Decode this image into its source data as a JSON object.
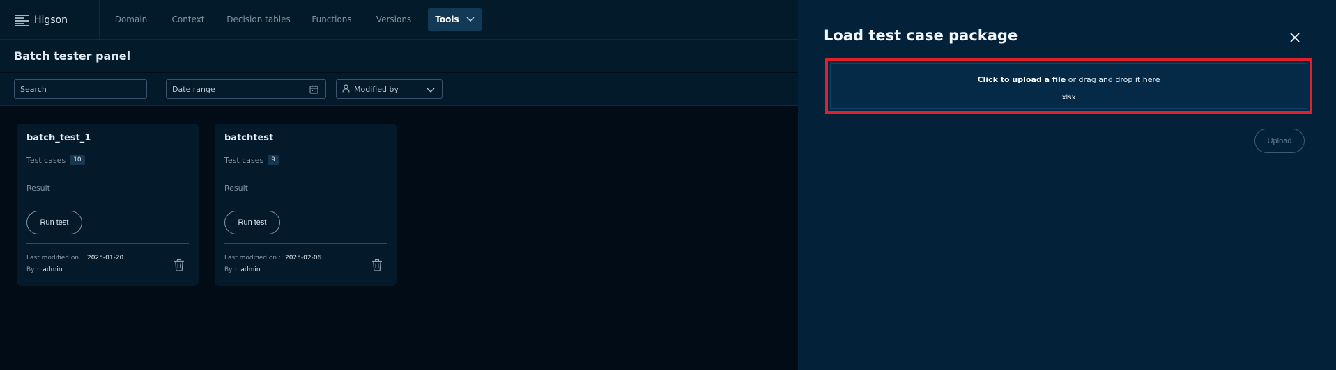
{
  "app": {
    "name": "Higson"
  },
  "nav": {
    "items": [
      {
        "label": "Domain"
      },
      {
        "label": "Context"
      },
      {
        "label": "Decision tables"
      },
      {
        "label": "Functions"
      },
      {
        "label": "Versions"
      }
    ],
    "tools": {
      "label": "Tools",
      "icon": "chevron-down-icon"
    }
  },
  "page": {
    "title": "Batch tester panel"
  },
  "filters": {
    "search_placeholder": "Search",
    "date_range": "Date range",
    "modified_by": "Modified by"
  },
  "cards": [
    {
      "title": "batch_test_1",
      "test_cases_label": "Test cases",
      "test_cases_count": "10",
      "result_label": "Result",
      "run_label": "Run test",
      "modified_label": "Last modified on :",
      "modified_date": "2025-01-20",
      "by_label": "By :",
      "by_user": "admin"
    },
    {
      "title": "batchtest",
      "test_cases_label": "Test cases",
      "test_cases_count": "9",
      "result_label": "Result",
      "run_label": "Run test",
      "modified_label": "Last modified on :",
      "modified_date": "2025-02-06",
      "by_label": "By :",
      "by_user": "admin"
    }
  ],
  "panel": {
    "title": "Load test case package",
    "upload_click": "Click to upload a file",
    "upload_rest": " or drag and drop it here",
    "upload_ext": "xlsx",
    "upload_button": "Upload"
  },
  "colors": {
    "background": "#010c16",
    "panel": "#03223a",
    "highlight": "#e0202a",
    "tools_active": "#123a57"
  }
}
